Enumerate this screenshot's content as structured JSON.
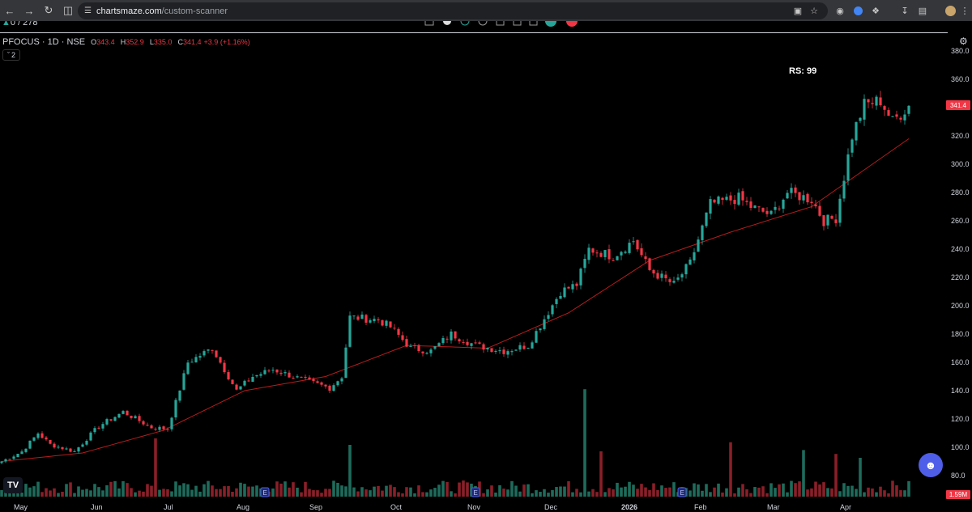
{
  "browser": {
    "url_host": "chartsmaze.com",
    "url_path": "/custom-scanner",
    "tab_counter": "0 / 278"
  },
  "chart_header": {
    "symbol": "PFOCUS · 1D · NSE",
    "open_key": "O",
    "open": "343.4",
    "high_key": "H",
    "high": "352.9",
    "low_key": "L",
    "low": "335.0",
    "close_key": "C",
    "close": "341.4",
    "change": "+3.9 (+1.16%)",
    "indicator_count": "2"
  },
  "rs_label": "RS: 99",
  "last_price_tag": "341.4",
  "volume_tag": "1.59M",
  "colors": {
    "up": "#26a69a",
    "down": "#f23645",
    "ma": "#b71c1c",
    "vol_up": "#1e6b5b",
    "vol_down": "#8a1f28"
  },
  "chart_data": {
    "type": "candlestick",
    "ylim": [
      70,
      390
    ],
    "yticks": [
      "380.0",
      "360.0",
      "340.0",
      "320.0",
      "300.0",
      "280.0",
      "260.0",
      "240.0",
      "220.0",
      "200.0",
      "180.0",
      "160.0",
      "140.0",
      "120.0",
      "100.0",
      "80.0"
    ],
    "ytick_values": [
      380,
      360,
      340,
      320,
      300,
      280,
      260,
      240,
      220,
      200,
      180,
      160,
      140,
      120,
      100,
      80
    ],
    "xticks": [
      "May",
      "Jun",
      "Jul",
      "Aug",
      "Sep",
      "Oct",
      "Nov",
      "Dec",
      "2026",
      "Feb",
      "Mar",
      "Apr"
    ],
    "xtick_index": [
      3,
      22,
      40,
      58,
      76,
      96,
      115,
      134,
      153,
      171,
      189,
      207
    ],
    "earnings_markers": [
      65,
      117,
      168
    ],
    "earnings_label": "E",
    "close_anchors": [
      [
        0,
        90
      ],
      [
        5,
        97
      ],
      [
        9,
        110
      ],
      [
        12,
        102
      ],
      [
        18,
        97
      ],
      [
        24,
        115
      ],
      [
        30,
        125
      ],
      [
        37,
        114
      ],
      [
        41,
        113
      ],
      [
        46,
        160
      ],
      [
        52,
        170
      ],
      [
        58,
        140
      ],
      [
        62,
        150
      ],
      [
        67,
        155
      ],
      [
        72,
        150
      ],
      [
        76,
        146
      ],
      [
        81,
        142
      ],
      [
        84,
        150
      ],
      [
        86,
        192
      ],
      [
        93,
        190
      ],
      [
        96,
        185
      ],
      [
        101,
        170
      ],
      [
        106,
        168
      ],
      [
        111,
        180
      ],
      [
        117,
        172
      ],
      [
        124,
        168
      ],
      [
        130,
        172
      ],
      [
        138,
        210
      ],
      [
        142,
        215
      ],
      [
        145,
        240
      ],
      [
        151,
        235
      ],
      [
        156,
        246
      ],
      [
        160,
        225
      ],
      [
        166,
        215
      ],
      [
        170,
        230
      ],
      [
        175,
        272
      ],
      [
        182,
        276
      ],
      [
        185,
        270
      ],
      [
        190,
        264
      ],
      [
        194,
        280
      ],
      [
        200,
        275
      ],
      [
        203,
        260
      ],
      [
        206,
        262
      ],
      [
        210,
        320
      ],
      [
        213,
        342
      ],
      [
        217,
        345
      ],
      [
        220,
        330
      ],
      [
        224,
        341.4
      ]
    ],
    "ma_anchors": [
      [
        0,
        90
      ],
      [
        20,
        96
      ],
      [
        40,
        112
      ],
      [
        60,
        140
      ],
      [
        80,
        150
      ],
      [
        100,
        172
      ],
      [
        120,
        170
      ],
      [
        140,
        195
      ],
      [
        160,
        232
      ],
      [
        180,
        252
      ],
      [
        200,
        270
      ],
      [
        215,
        300
      ],
      [
        224,
        318
      ]
    ],
    "volume_spikes": [
      [
        38,
        0.45
      ],
      [
        86,
        0.4
      ],
      [
        144,
        0.83
      ],
      [
        148,
        0.35
      ],
      [
        180,
        0.42
      ],
      [
        198,
        0.36
      ],
      [
        206,
        0.33
      ],
      [
        212,
        0.3
      ]
    ]
  }
}
